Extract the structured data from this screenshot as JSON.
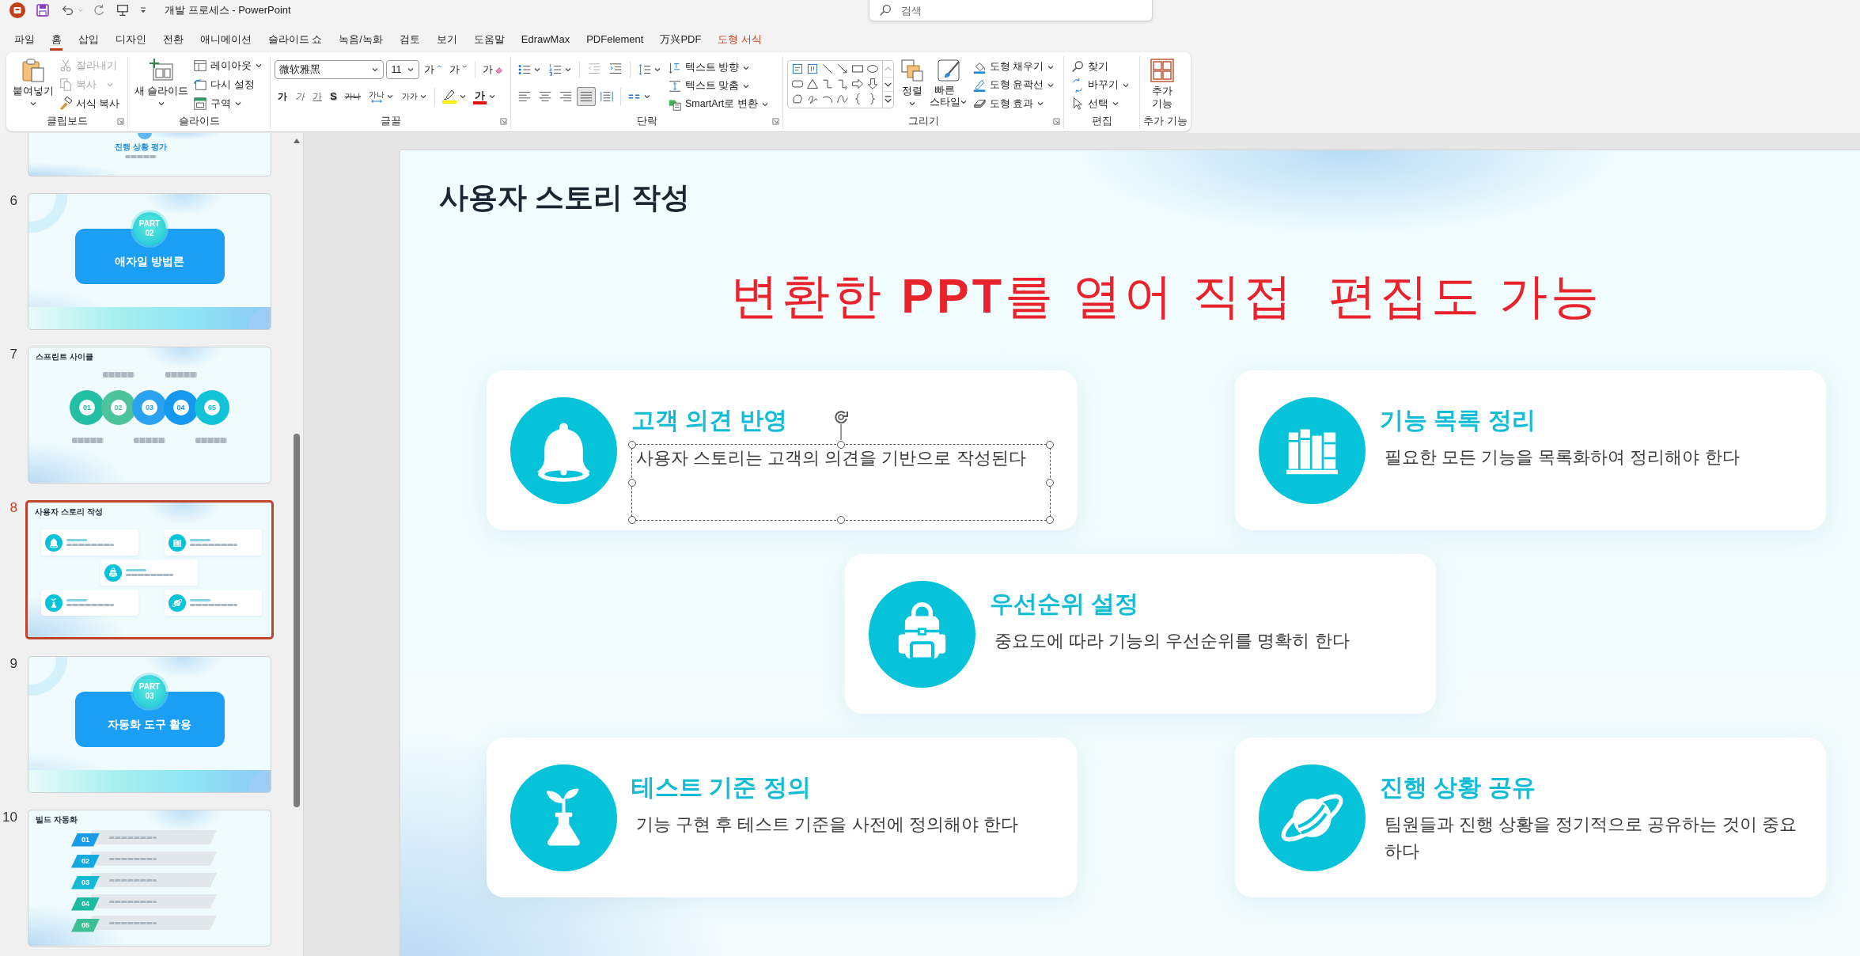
{
  "title_bar": {
    "title": "개발 프로세스 - PowerPoint",
    "search": {
      "placeholder": "검색"
    }
  },
  "tabs": [
    {
      "label": "파일",
      "selected": false,
      "contextual": false
    },
    {
      "label": "홈",
      "selected": true,
      "contextual": false
    },
    {
      "label": "삽입",
      "selected": false,
      "contextual": false
    },
    {
      "label": "디자인",
      "selected": false,
      "contextual": false
    },
    {
      "label": "전환",
      "selected": false,
      "contextual": false
    },
    {
      "label": "애니메이션",
      "selected": false,
      "contextual": false
    },
    {
      "label": "슬라이드 쇼",
      "selected": false,
      "contextual": false
    },
    {
      "label": "녹음/녹화",
      "selected": false,
      "contextual": false
    },
    {
      "label": "검토",
      "selected": false,
      "contextual": false
    },
    {
      "label": "보기",
      "selected": false,
      "contextual": false
    },
    {
      "label": "도움말",
      "selected": false,
      "contextual": false
    },
    {
      "label": "EdrawMax",
      "selected": false,
      "contextual": false
    },
    {
      "label": "PDFelement",
      "selected": false,
      "contextual": false
    },
    {
      "label": "万兴PDF",
      "selected": false,
      "contextual": false
    },
    {
      "label": "도형 서식",
      "selected": false,
      "contextual": true
    }
  ],
  "ribbon": {
    "clipboard": {
      "label": "클립보드",
      "paste": "붙여넣기",
      "buttons": [
        {
          "label": "잘라내기",
          "disabled": true,
          "dropdown": false
        },
        {
          "label": "복사",
          "disabled": true,
          "dropdown": true
        },
        {
          "label": "서식 복사",
          "disabled": false,
          "dropdown": false
        }
      ]
    },
    "slides": {
      "label": "슬라이드",
      "new_slide": "새 슬라이드",
      "buttons": [
        {
          "label": "레이아웃",
          "dropdown": true
        },
        {
          "label": "다시 설정",
          "dropdown": false
        },
        {
          "label": "구역",
          "dropdown": true
        }
      ]
    },
    "font": {
      "label": "글꼴",
      "font_name": "微软雅黑",
      "font_size": "11",
      "size_buttons": [
        {
          "label": "가",
          "kind": "grow"
        },
        {
          "label": "가",
          "kind": "shrink"
        }
      ],
      "clear_button": "가",
      "format_buttons": [
        {
          "label": "가",
          "kind": "bold"
        },
        {
          "label": "가",
          "kind": "italic"
        },
        {
          "label": "가",
          "kind": "underline"
        },
        {
          "label": "S",
          "kind": "shadow"
        },
        {
          "label": "가나",
          "kind": "strike"
        },
        {
          "label": "가나",
          "kind": "spacing"
        },
        {
          "label": "가가",
          "kind": "case"
        }
      ],
      "font_color_button": "가"
    },
    "paragraph": {
      "label": "단락",
      "align_buttons": [
        {
          "kind": "left",
          "selected": false
        },
        {
          "kind": "center",
          "selected": false
        },
        {
          "kind": "right",
          "selected": false
        },
        {
          "kind": "justify",
          "selected": true
        },
        {
          "kind": "distribute",
          "selected": false
        }
      ],
      "buttons": [
        {
          "label": "텍스트 방향"
        },
        {
          "label": "텍스트 맞춤"
        },
        {
          "label": "SmartArt로 변환"
        }
      ]
    },
    "drawing": {
      "label": "그리기",
      "arrange": "정렬",
      "quick_styles": "빠른 스타일",
      "buttons": [
        {
          "label": "도형 채우기"
        },
        {
          "label": "도형 윤곽선"
        },
        {
          "label": "도형 효과"
        }
      ]
    },
    "editing": {
      "label": "편집",
      "buttons": [
        {
          "label": "찾기",
          "dropdown": false
        },
        {
          "label": "바꾸기",
          "dropdown": true
        },
        {
          "label": "선택",
          "dropdown": true
        }
      ]
    },
    "add_ins": {
      "label": "추가 기능",
      "button": "추가 기능"
    }
  },
  "slide_panel": {
    "slides": [
      {
        "kind": "partial",
        "caption": "진행 상황 평가",
        "selected": false
      },
      {
        "number": "6",
        "kind": "section",
        "part_label": "PART",
        "part_number": "02",
        "title": "애자일 방법론",
        "selected": false
      },
      {
        "number": "7",
        "kind": "cycle",
        "title": "스프린트 사이클",
        "steps": [
          {
            "label": "01",
            "color": "#23bfa5"
          },
          {
            "label": "02",
            "color": "#4cc39b"
          },
          {
            "label": "03",
            "color": "#2aa2ef"
          },
          {
            "label": "04",
            "color": "#1598f0"
          },
          {
            "label": "05",
            "color": "#12c2d6"
          }
        ],
        "selected": false
      },
      {
        "number": "8",
        "kind": "cards",
        "title": "사용자 스토리 작성",
        "selected": true
      },
      {
        "number": "9",
        "kind": "section",
        "part_label": "PART",
        "part_number": "03",
        "title": "자동화 도구 활용",
        "selected": false
      },
      {
        "number": "10",
        "kind": "list",
        "title": "빌드 자동화",
        "steps": [
          {
            "label": "01",
            "color": "#1a9be6"
          },
          {
            "label": "02",
            "color": "#12a9e0"
          },
          {
            "label": "03",
            "color": "#12bad3"
          },
          {
            "label": "04",
            "color": "#1dbaa2"
          },
          {
            "label": "05",
            "color": "#3bbf93"
          }
        ],
        "selected": false
      }
    ]
  },
  "slide": {
    "title": "사용자 스토리 작성",
    "headline": "변환한 **PPT**를 열어 직접  편집도 가능",
    "cards": [
      {
        "title": "고객 의견 반영",
        "description": "사용자 스토리는 고객의 의견을 기반으로 작성된다",
        "description_selected": true
      },
      {
        "title": "기능 목록 정리",
        "description": "필요한 모든 기능을 목록화하여 정리해야 한다",
        "description_selected": false
      },
      {
        "title": "우선순위 설정",
        "description": "중요도에 따라 기능의 우선순위를 명확히 한다",
        "description_selected": false
      },
      {
        "title": "테스트 기준 정의",
        "description": "기능 구현 후 테스트 기준을 사전에 정의해야 한다",
        "description_selected": false
      },
      {
        "title": "진행 상황 공유",
        "description": "팀원들과 진행 상황을 정기적으로 공유하는 것이 중요하다",
        "description_selected": false
      }
    ]
  }
}
